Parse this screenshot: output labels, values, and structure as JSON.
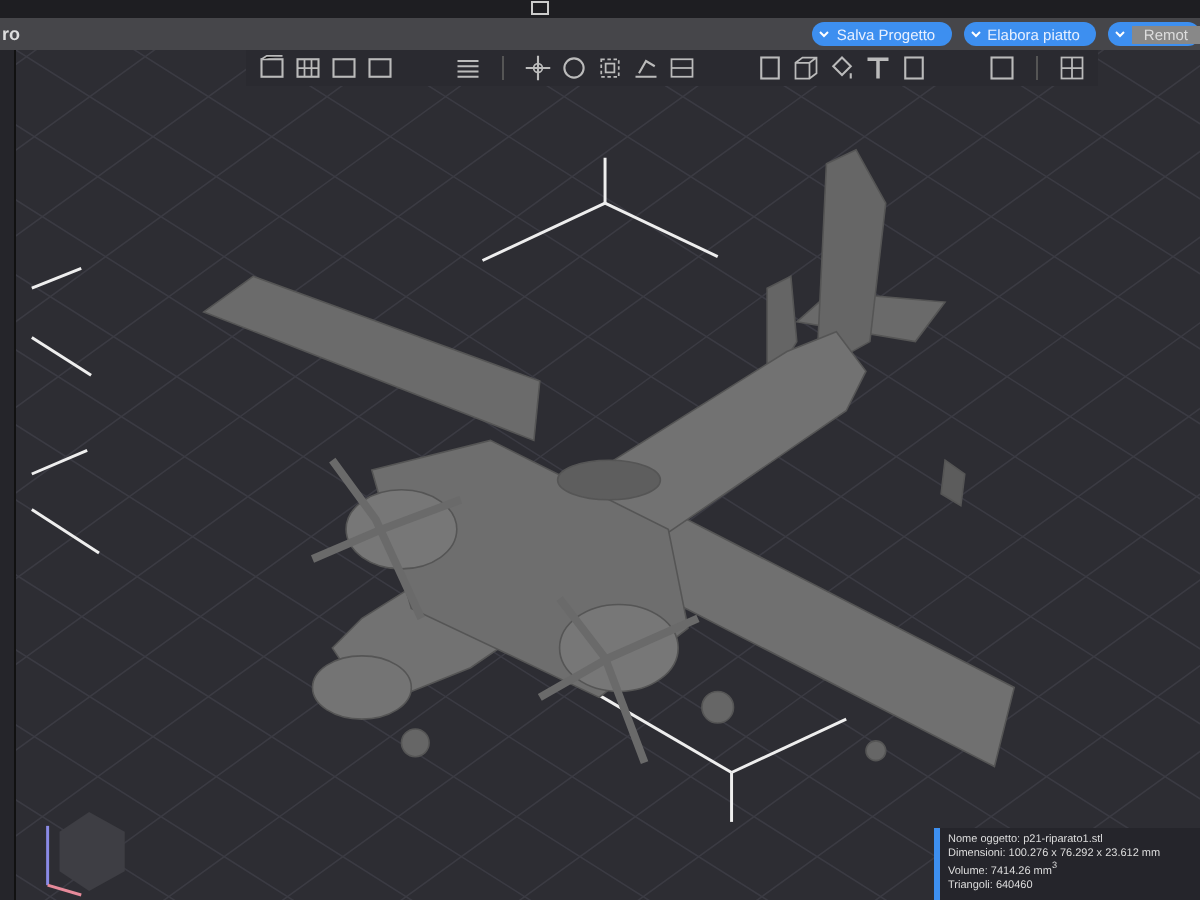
{
  "header": {
    "title": "ro",
    "buttons": [
      {
        "label": "Salva Progetto",
        "disabled": false
      },
      {
        "label": "Elabora piatto",
        "disabled": false
      },
      {
        "label": "Remot",
        "disabled": true
      }
    ]
  },
  "info_panel": {
    "lines": [
      "Nome oggetto: p21-riparato1.stl",
      "Dimensioni: 100.276 x 76.292 x 23.612 mm",
      "Volume: 7414.26 mm$^{3}$",
      "Triangoli: 640460"
    ]
  }
}
